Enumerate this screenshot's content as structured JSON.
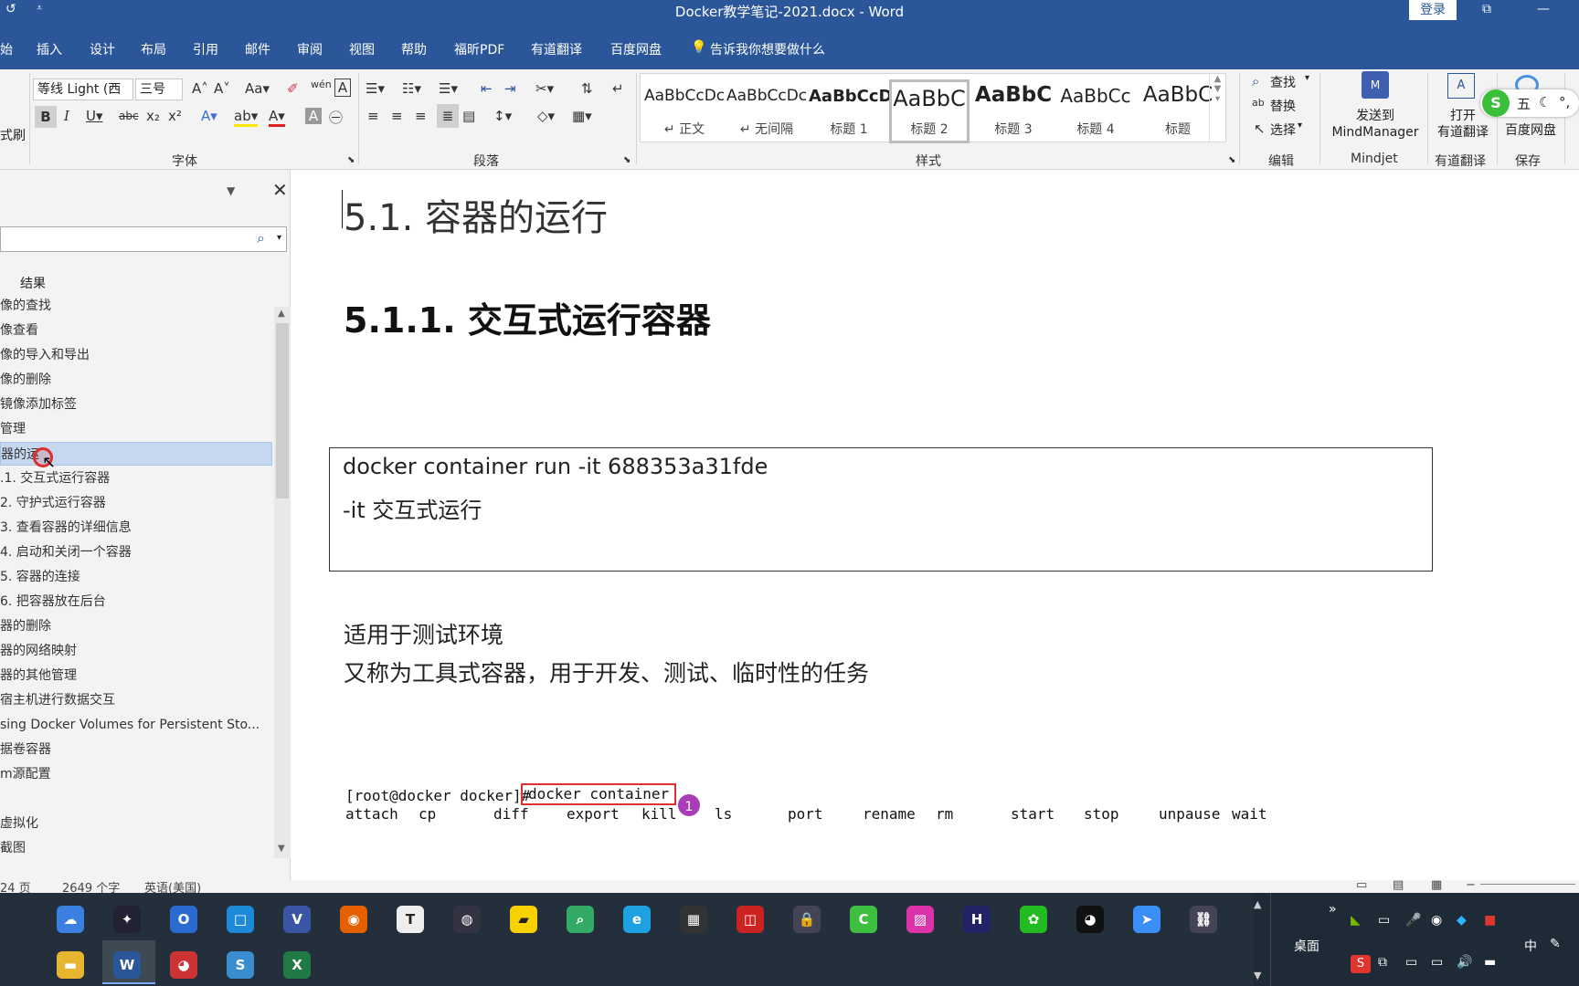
{
  "window": {
    "title": "Docker教学笔记-2021.docx  -  Word",
    "login": "登录"
  },
  "tabs": [
    "始",
    "插入",
    "设计",
    "布局",
    "引用",
    "邮件",
    "审阅",
    "视图",
    "帮助",
    "福昕PDF",
    "有道翻译",
    "百度网盘"
  ],
  "tell_me": "告诉我你想要做什么",
  "ribbon": {
    "left_clip_label": "式刷",
    "font_name": "等线 Light (西",
    "font_size": "三号",
    "font_group": "字体",
    "paragraph_group": "段落",
    "styles_group": "样式",
    "edit_group": "编辑",
    "styles": [
      {
        "sample": "AaBbCcDc",
        "name": "↵ 正文"
      },
      {
        "sample": "AaBbCcDc",
        "name": "↵ 无间隔"
      },
      {
        "sample": "AaBbCcD",
        "name": "标题 1"
      },
      {
        "sample": "AaBbC",
        "name": "标题 2"
      },
      {
        "sample": "AaBbC",
        "name": "标题 3"
      },
      {
        "sample": "AaBbCc",
        "name": "标题 4"
      },
      {
        "sample": "AaBbC",
        "name": "标题"
      }
    ],
    "find": "查找",
    "replace": "替换",
    "select": "选择",
    "mindmanager": [
      "发送到",
      "MindManager",
      "Mindjet"
    ],
    "youdao": [
      "打开",
      "有道翻译",
      "有道翻译"
    ],
    "baidu": [
      "百度网盘",
      "保存"
    ]
  },
  "nav": {
    "search_placeholder": "",
    "results_label": "结果",
    "items": [
      "像的查找",
      "像查看",
      "像的导入和导出",
      "像的删除",
      "镜像添加标签",
      "管理",
      "器的运",
      ".1. 交互式运行容器",
      "2. 守护式运行容器",
      "3. 查看容器的详细信息",
      "4. 启动和关闭一个容器",
      "5. 容器的连接",
      "6. 把容器放在后台",
      "器的删除",
      "器的网络映射",
      "器的其他管理",
      "宿主机进行数据交互",
      "sing Docker Volumes for Persistent Sto...",
      "据卷容器",
      "m源配置",
      "",
      "虚拟化",
      "截图"
    ],
    "selected_index": 6
  },
  "doc": {
    "h2": "5.1.  容器的运行",
    "h3": "5.1.1.  交互式运行容器",
    "box_line1": "docker container run -it 688353a31fde",
    "box_line2": "-it  交互式运行",
    "para1": "适用于测试环境",
    "para2": "又称为工具式容器，用于开发、测试、临时性的任务",
    "term_prompt": "[root@docker docker]#",
    "term_cmd": "docker container",
    "term_badge": "1",
    "term_completions": [
      "attach",
      "cp",
      "diff",
      "export",
      "kill",
      "ls",
      "port",
      "rename",
      "rm",
      "start",
      "stop",
      "unpause",
      "wait"
    ]
  },
  "status": {
    "page": "24 页",
    "words": "2649 个字",
    "lang": "英语(美国)"
  },
  "taskbar": {
    "desktop_label": "桌面",
    "ime_label": "中"
  },
  "colors": {
    "word_blue": "#2b579a",
    "ribbon_bg": "#f3f3f3",
    "nav_selected": "#c5d8f0",
    "terminal_highlight": "#e03131",
    "badge_purple": "#a93db8"
  }
}
